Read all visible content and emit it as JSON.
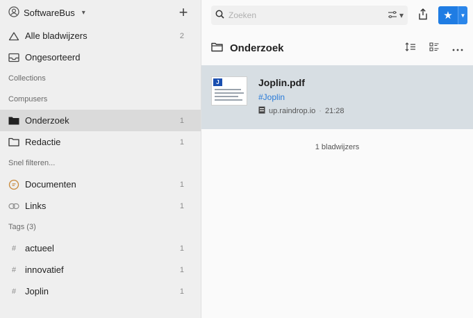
{
  "sidebar": {
    "account_name": "SoftwareBus",
    "add_label": "+",
    "all_bookmarks": {
      "label": "Alle bladwijzers",
      "count": "2"
    },
    "unsorted": {
      "label": "Ongesorteerd"
    },
    "collections_label": "Collections",
    "group_label": "Compusers",
    "collections": [
      {
        "label": "Onderzoek",
        "count": "1",
        "icon": "folder-filled-icon"
      },
      {
        "label": "Redactie",
        "count": "1",
        "icon": "folder-icon"
      }
    ],
    "quick_filter_label": "Snel filteren...",
    "filters": [
      {
        "label": "Documenten",
        "count": "1",
        "icon": "document-icon"
      },
      {
        "label": "Links",
        "count": "1",
        "icon": "link-icon"
      }
    ],
    "tags_label": "Tags (3)",
    "tags": [
      {
        "label": "actueel",
        "count": "1"
      },
      {
        "label": "innovatief",
        "count": "1"
      },
      {
        "label": "Joplin",
        "count": "1"
      }
    ],
    "hash": "#"
  },
  "toolbar": {
    "search_placeholder": "Zoeken",
    "filter_caret": "▾"
  },
  "folder": {
    "title": "Onderzoek"
  },
  "bookmarks": [
    {
      "title": "Joplin.pdf",
      "tag": "#Joplin",
      "domain": "up.raindrop.io",
      "sep": "·",
      "time": "21:28",
      "thumb_letter": "J"
    }
  ],
  "bookmark_count_label": "1 bladwijzers",
  "colors": {
    "accent": "#1f7ce3",
    "tag": "#2a7bd8",
    "selected_row": "#d7dee3",
    "active_collection": "#dadada"
  }
}
